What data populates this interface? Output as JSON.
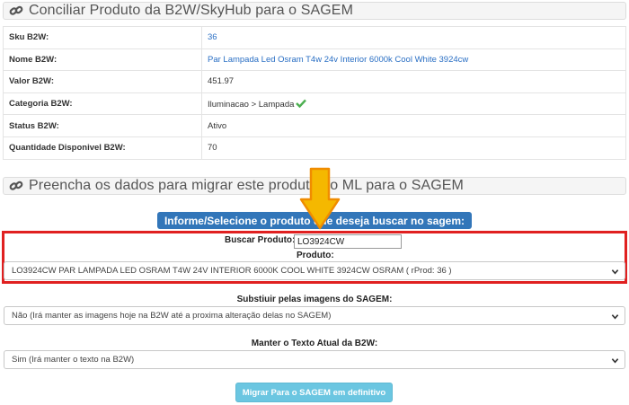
{
  "panel1": {
    "title": "Conciliar Produto da B2W/SkyHub para o SAGEM",
    "icon": "link-icon"
  },
  "details": [
    {
      "label": "Sku B2W:",
      "value": "36",
      "link": true
    },
    {
      "label": "Nome B2W:",
      "value": "Par Lampada Led Osram T4w 24v Interior 6000k Cool White 3924cw",
      "link": true
    },
    {
      "label": "Valor B2W:",
      "value": "451.97",
      "link": false
    },
    {
      "label": "Categoria B2W:",
      "value": "Iluminacao > Lampada",
      "link": false,
      "icon": "check-icon"
    },
    {
      "label": "Status B2W:",
      "value": "Ativo",
      "link": false
    },
    {
      "label": "Quantidade Disponivel B2W:",
      "value": "70",
      "link": false
    }
  ],
  "panel2": {
    "title": "Preencha os dados para migrar este produto do ML para o SAGEM",
    "icon": "link-icon"
  },
  "banner": "Informe/Selecione o produto que deseja buscar no sagem:",
  "search": {
    "label": "Buscar Produto:",
    "value": "LO3924CW"
  },
  "produto": {
    "label": "Produto:",
    "selected": "LO3924CW PAR LAMPADA LED OSRAM T4W 24V INTERIOR 6000K COOL WHITE 3924CW OSRAM ( rProd: 36 )"
  },
  "imagens": {
    "label": "Substiuir pelas imagens do SAGEM:",
    "selected": "Não (Irá manter as imagens hoje na B2W até a proxima alteração delas no SAGEM)"
  },
  "texto": {
    "label": "Manter o Texto Atual da B2W:",
    "selected": "Sim (Irá manter o texto na B2W)"
  },
  "button": {
    "label": "Migrar Para o SAGEM em definitivo"
  },
  "colors": {
    "accent": "#3276b9",
    "button": "#5bc0de",
    "highlight": "#e02020",
    "arrow": "#f5b800",
    "link": "#2a6fc4",
    "check": "#4caf50"
  }
}
